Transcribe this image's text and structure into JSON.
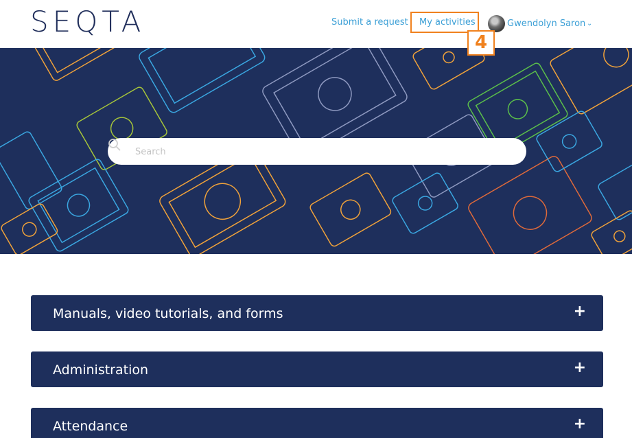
{
  "header": {
    "logo": "SEQTA",
    "nav": {
      "submit_request": "Submit a request",
      "my_activities": "My activities"
    },
    "user": {
      "name": "Gwendolyn Saron",
      "chevron_icon": "chevron-down-icon"
    },
    "step_badge": "4"
  },
  "hero": {
    "search": {
      "placeholder": "Search",
      "value": ""
    }
  },
  "sections": [
    {
      "label": "Manuals, video tutorials, and forms",
      "toggle": "+"
    },
    {
      "label": "Administration",
      "toggle": "+"
    },
    {
      "label": "Attendance",
      "toggle": "+"
    }
  ],
  "colors": {
    "brand_navy": "#1e2f5c",
    "link_blue": "#3b9fd6",
    "highlight_orange": "#f0811e"
  }
}
